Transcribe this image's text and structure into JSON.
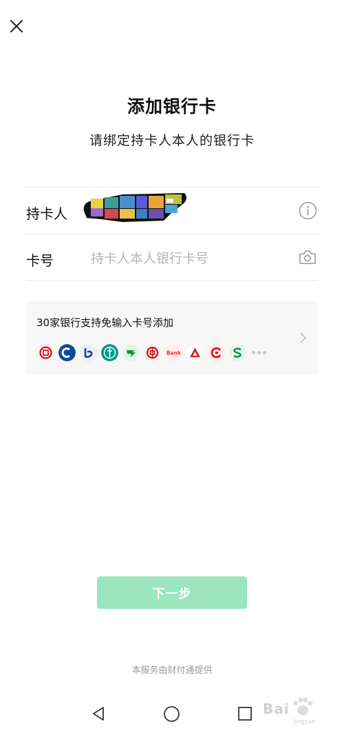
{
  "header": {
    "close_icon": "close-icon"
  },
  "page": {
    "title": "添加银行卡",
    "subtitle": "请绑定持卡人本人的银行卡"
  },
  "form": {
    "holder_label": "持卡人",
    "holder_value_masked": true,
    "holder_info_icon": "info-icon",
    "card_label": "卡号",
    "card_placeholder": "持卡人本人银行卡号",
    "card_value": "",
    "card_scan_icon": "camera-icon"
  },
  "bank_panel": {
    "text": "30家银行支持免输入卡号添加",
    "banks": [
      {
        "icon": "icbc-logo-icon",
        "color": "#c7000b"
      },
      {
        "icon": "ccb-logo-icon",
        "color": "#0a4a9c"
      },
      {
        "icon": "bocom-logo-icon",
        "color": "#1c3f8c"
      },
      {
        "icon": "abc-logo-icon",
        "color": "#009a82"
      },
      {
        "icon": "psbc-logo-icon",
        "color": "#00913a"
      },
      {
        "icon": "boc-logo-icon",
        "color": "#b81c22"
      },
      {
        "icon": "bank-text-logo-icon",
        "color": "#e8382f",
        "text": "Bank"
      },
      {
        "icon": "cmbc-logo-icon",
        "color": "#d9261c"
      },
      {
        "icon": "citic-logo-icon",
        "color": "#e60012"
      },
      {
        "icon": "spdb-logo-icon",
        "color": "#00924a"
      }
    ],
    "more_icon": "more-dots-icon",
    "arrow_icon": "chevron-right-icon"
  },
  "actions": {
    "next_label": "下一步",
    "next_color": "#9be5bf"
  },
  "footer": {
    "note": "本服务由财付通提供"
  },
  "nav_bar": {
    "back_icon": "back-triangle-icon",
    "home_icon": "home-circle-icon",
    "recent_icon": "recent-square-icon"
  },
  "watermark": {
    "text": "Bai",
    "sub": "jingyan"
  }
}
